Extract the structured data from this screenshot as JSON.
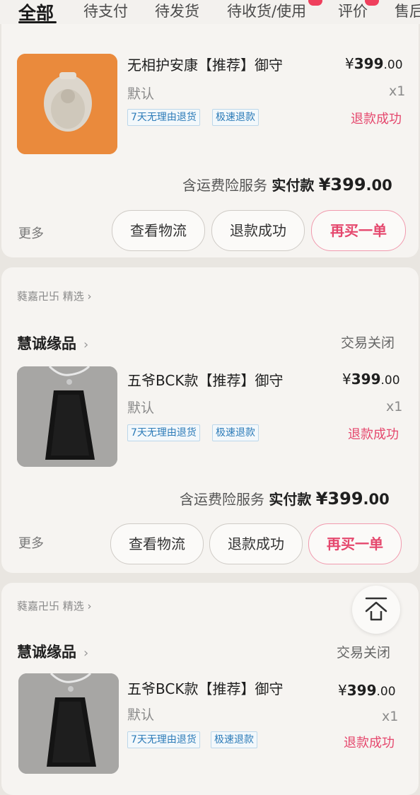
{
  "tabs": [
    {
      "label": "全部",
      "active": true
    },
    {
      "label": "待支付"
    },
    {
      "label": "待发货"
    },
    {
      "label": "待收货/使用"
    },
    {
      "label": "评价"
    },
    {
      "label": "售后"
    }
  ],
  "orders": [
    {
      "title": "无相护安康【推荐】御守",
      "price_symbol": "¥",
      "price_int": "399",
      "price_dec": ".00",
      "variant": "默认",
      "qty": "x1",
      "tags": [
        "7天无理由退货",
        "极速退款"
      ],
      "item_status": "退款成功",
      "summary_prefix": "含运费险服务",
      "summary_label": "实付款",
      "total_int": "¥399",
      "total_dec": ".00",
      "more": "更多",
      "buttons": [
        "查看物流",
        "退款成功",
        "再买一单"
      ]
    },
    {
      "channel": "蕤嘉卍卐 精选 ›",
      "shop_name": "慧诚缘品",
      "shop_chevron": "›",
      "shop_status": "交易关闭",
      "title": "五爷BCK款【推荐】御守",
      "price_symbol": "¥",
      "price_int": "399",
      "price_dec": ".00",
      "variant": "默认",
      "qty": "x1",
      "tags": [
        "7天无理由退货",
        "极速退款"
      ],
      "item_status": "退款成功",
      "summary_prefix": "含运费险服务",
      "summary_label": "实付款",
      "total_int": "¥399",
      "total_dec": ".00",
      "more": "更多",
      "buttons": [
        "查看物流",
        "退款成功",
        "再买一单"
      ]
    },
    {
      "channel": "蕤嘉卍卐 精选 ›",
      "shop_name": "慧诚缘品",
      "shop_chevron": "›",
      "shop_status": "交易关闭",
      "title": "五爷BCK款【推荐】御守",
      "price_symbol": "¥",
      "price_int": "399",
      "price_dec": ".00",
      "variant": "默认",
      "qty": "x1",
      "tags": [
        "7天无理由退货",
        "极速退款"
      ],
      "item_status": "退款成功"
    }
  ],
  "scroll_top_icon": "arrow-up-to-top-icon",
  "colors": {
    "accent_red": "#e5476d",
    "tag_blue": "#2c7bb8",
    "page_bg": "#e9e6e1",
    "card_bg": "#f6f4f1"
  }
}
